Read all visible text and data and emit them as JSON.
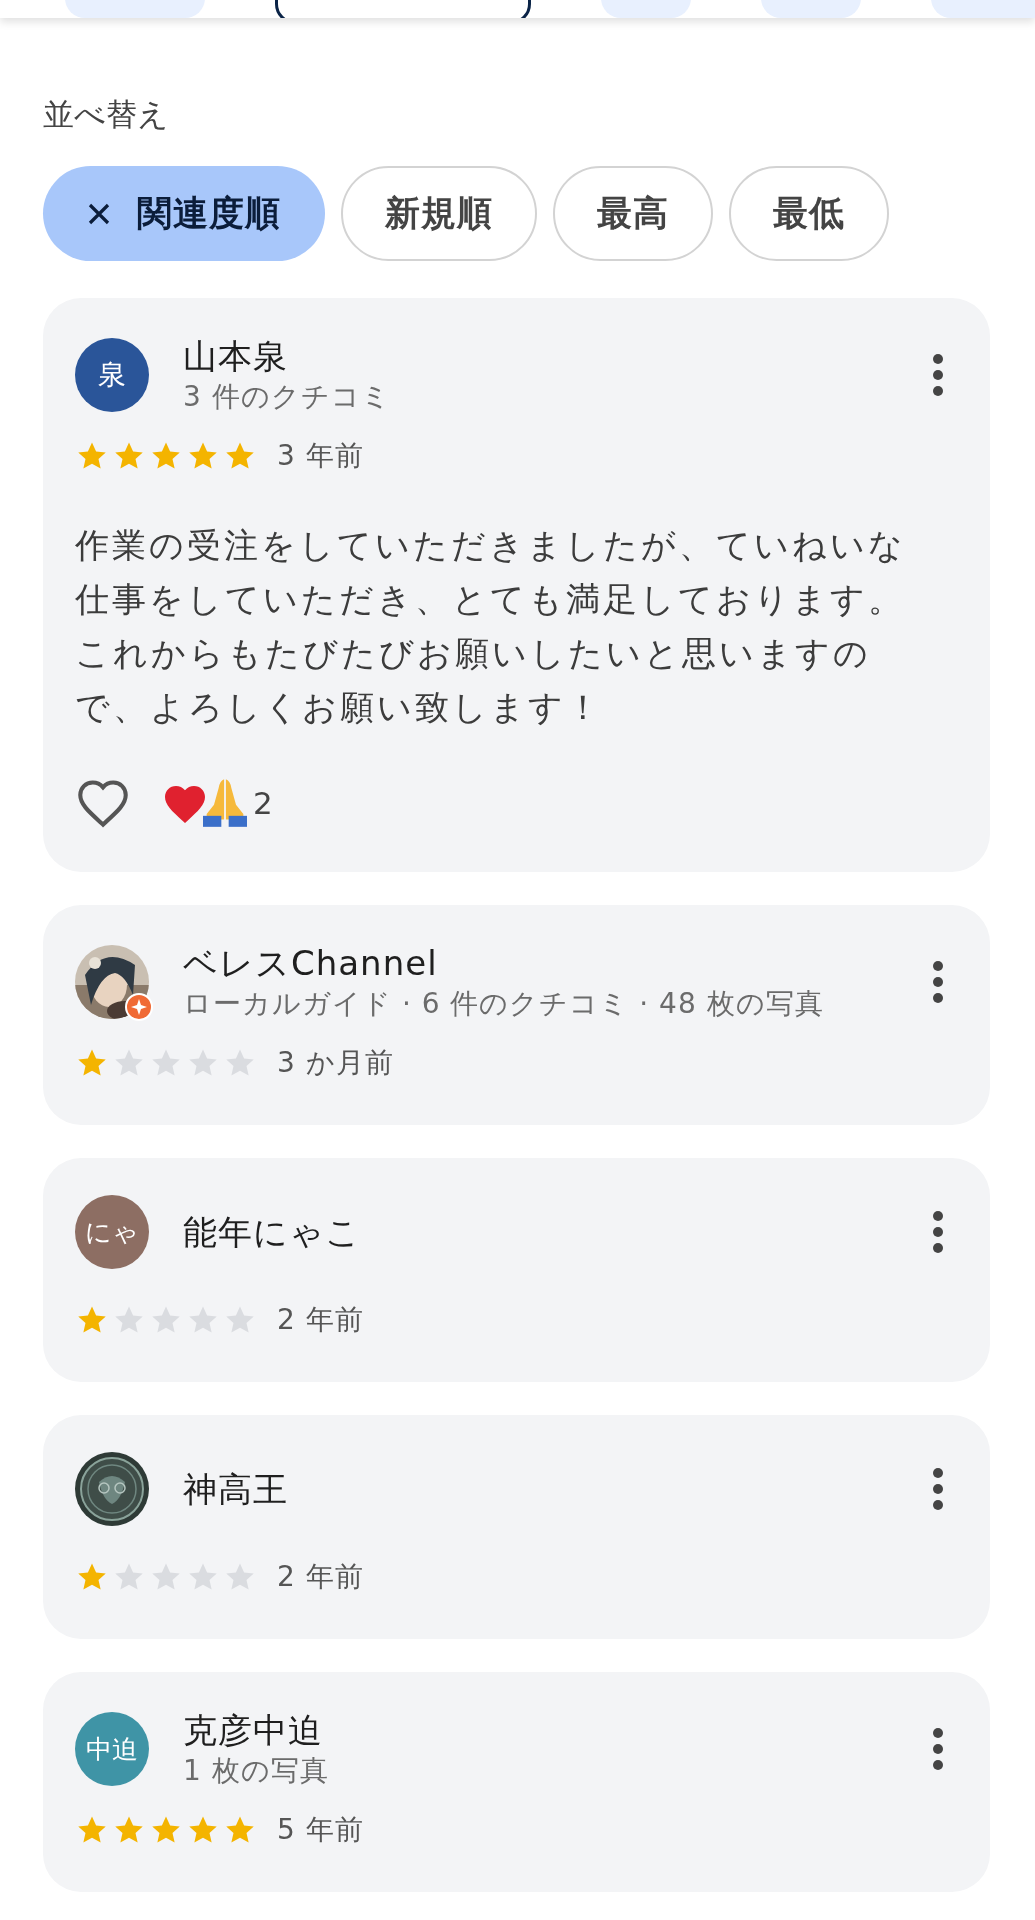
{
  "top_tabs": [
    {
      "selected": false
    },
    {
      "selected": true
    },
    {
      "selected": false
    },
    {
      "selected": false
    },
    {
      "selected": false
    }
  ],
  "sort_label": "並べ替え",
  "sort_chips": [
    {
      "label": "関連度順",
      "selected": true
    },
    {
      "label": "新規順",
      "selected": false
    },
    {
      "label": "最高",
      "selected": false
    },
    {
      "label": "最低",
      "selected": false
    }
  ],
  "reviews": [
    {
      "avatar": {
        "kind": "letter",
        "text": "泉",
        "color": "#2a5599"
      },
      "name": "山本泉",
      "subtitle": "3 件のクチコミ",
      "stars": 5,
      "time": "3 年前",
      "text": "作業の受注をしていただきましたが、ていねいな仕事をしていただき、とても満足しております。これからもたびたびお願いしたいと思いますので、よろしくお願い致します！",
      "reactions": {
        "count": "2"
      }
    },
    {
      "avatar": {
        "kind": "picture",
        "local_guide": true
      },
      "name": "ベレスChannel",
      "subtitle": "ローカルガイド · 6 件のクチコミ · 48 枚の写真",
      "stars": 1,
      "time": "3 か月前"
    },
    {
      "avatar": {
        "kind": "letter",
        "text": "にゃ",
        "color": "#8d6e63"
      },
      "name": "能年にゃこ",
      "stars": 1,
      "time": "2 年前"
    },
    {
      "avatar": {
        "kind": "emblem"
      },
      "name": "神高王",
      "stars": 1,
      "time": "2 年前"
    },
    {
      "avatar": {
        "kind": "letter",
        "text": "中迫",
        "color": "#3f94a6"
      },
      "name": "克彦中迫",
      "subtitle": "1 枚の写真",
      "stars": 5,
      "time": "5 年前"
    }
  ]
}
